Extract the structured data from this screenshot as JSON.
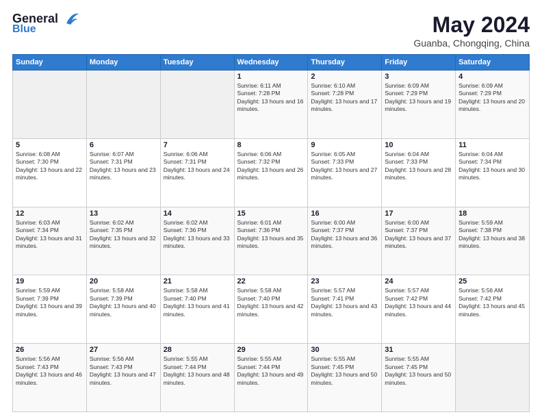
{
  "header": {
    "logo_line1": "General",
    "logo_line2": "Blue",
    "month": "May 2024",
    "location": "Guanba, Chongqing, China"
  },
  "weekdays": [
    "Sunday",
    "Monday",
    "Tuesday",
    "Wednesday",
    "Thursday",
    "Friday",
    "Saturday"
  ],
  "weeks": [
    [
      {
        "day": "",
        "empty": true
      },
      {
        "day": "",
        "empty": true
      },
      {
        "day": "",
        "empty": true
      },
      {
        "day": "1",
        "sunrise": "6:11 AM",
        "sunset": "7:28 PM",
        "daylight": "13 hours and 16 minutes."
      },
      {
        "day": "2",
        "sunrise": "6:10 AM",
        "sunset": "7:28 PM",
        "daylight": "13 hours and 17 minutes."
      },
      {
        "day": "3",
        "sunrise": "6:09 AM",
        "sunset": "7:29 PM",
        "daylight": "13 hours and 19 minutes."
      },
      {
        "day": "4",
        "sunrise": "6:09 AM",
        "sunset": "7:29 PM",
        "daylight": "13 hours and 20 minutes."
      }
    ],
    [
      {
        "day": "5",
        "sunrise": "6:08 AM",
        "sunset": "7:30 PM",
        "daylight": "13 hours and 22 minutes."
      },
      {
        "day": "6",
        "sunrise": "6:07 AM",
        "sunset": "7:31 PM",
        "daylight": "13 hours and 23 minutes."
      },
      {
        "day": "7",
        "sunrise": "6:06 AM",
        "sunset": "7:31 PM",
        "daylight": "13 hours and 24 minutes."
      },
      {
        "day": "8",
        "sunrise": "6:06 AM",
        "sunset": "7:32 PM",
        "daylight": "13 hours and 26 minutes."
      },
      {
        "day": "9",
        "sunrise": "6:05 AM",
        "sunset": "7:33 PM",
        "daylight": "13 hours and 27 minutes."
      },
      {
        "day": "10",
        "sunrise": "6:04 AM",
        "sunset": "7:33 PM",
        "daylight": "13 hours and 28 minutes."
      },
      {
        "day": "11",
        "sunrise": "6:04 AM",
        "sunset": "7:34 PM",
        "daylight": "13 hours and 30 minutes."
      }
    ],
    [
      {
        "day": "12",
        "sunrise": "6:03 AM",
        "sunset": "7:34 PM",
        "daylight": "13 hours and 31 minutes."
      },
      {
        "day": "13",
        "sunrise": "6:02 AM",
        "sunset": "7:35 PM",
        "daylight": "13 hours and 32 minutes."
      },
      {
        "day": "14",
        "sunrise": "6:02 AM",
        "sunset": "7:36 PM",
        "daylight": "13 hours and 33 minutes."
      },
      {
        "day": "15",
        "sunrise": "6:01 AM",
        "sunset": "7:36 PM",
        "daylight": "13 hours and 35 minutes."
      },
      {
        "day": "16",
        "sunrise": "6:00 AM",
        "sunset": "7:37 PM",
        "daylight": "13 hours and 36 minutes."
      },
      {
        "day": "17",
        "sunrise": "6:00 AM",
        "sunset": "7:37 PM",
        "daylight": "13 hours and 37 minutes."
      },
      {
        "day": "18",
        "sunrise": "5:59 AM",
        "sunset": "7:38 PM",
        "daylight": "13 hours and 38 minutes."
      }
    ],
    [
      {
        "day": "19",
        "sunrise": "5:59 AM",
        "sunset": "7:39 PM",
        "daylight": "13 hours and 39 minutes."
      },
      {
        "day": "20",
        "sunrise": "5:58 AM",
        "sunset": "7:39 PM",
        "daylight": "13 hours and 40 minutes."
      },
      {
        "day": "21",
        "sunrise": "5:58 AM",
        "sunset": "7:40 PM",
        "daylight": "13 hours and 41 minutes."
      },
      {
        "day": "22",
        "sunrise": "5:58 AM",
        "sunset": "7:40 PM",
        "daylight": "13 hours and 42 minutes."
      },
      {
        "day": "23",
        "sunrise": "5:57 AM",
        "sunset": "7:41 PM",
        "daylight": "13 hours and 43 minutes."
      },
      {
        "day": "24",
        "sunrise": "5:57 AM",
        "sunset": "7:42 PM",
        "daylight": "13 hours and 44 minutes."
      },
      {
        "day": "25",
        "sunrise": "5:56 AM",
        "sunset": "7:42 PM",
        "daylight": "13 hours and 45 minutes."
      }
    ],
    [
      {
        "day": "26",
        "sunrise": "5:56 AM",
        "sunset": "7:43 PM",
        "daylight": "13 hours and 46 minutes."
      },
      {
        "day": "27",
        "sunrise": "5:56 AM",
        "sunset": "7:43 PM",
        "daylight": "13 hours and 47 minutes."
      },
      {
        "day": "28",
        "sunrise": "5:55 AM",
        "sunset": "7:44 PM",
        "daylight": "13 hours and 48 minutes."
      },
      {
        "day": "29",
        "sunrise": "5:55 AM",
        "sunset": "7:44 PM",
        "daylight": "13 hours and 49 minutes."
      },
      {
        "day": "30",
        "sunrise": "5:55 AM",
        "sunset": "7:45 PM",
        "daylight": "13 hours and 50 minutes."
      },
      {
        "day": "31",
        "sunrise": "5:55 AM",
        "sunset": "7:45 PM",
        "daylight": "13 hours and 50 minutes."
      },
      {
        "day": "",
        "empty": true
      }
    ]
  ]
}
